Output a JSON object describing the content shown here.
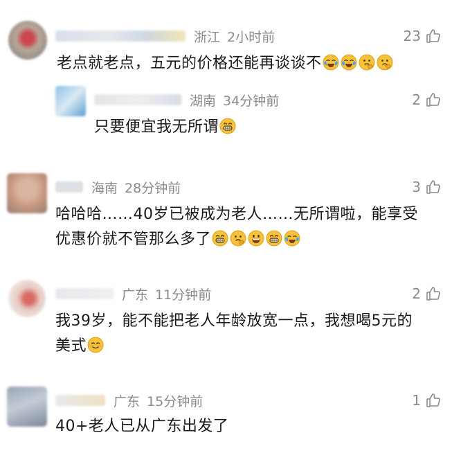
{
  "comments": [
    {
      "location": "浙江",
      "time": "2小时前",
      "likes": "23",
      "text": "老点就老点，五元的价格还能再谈谈不",
      "emojis": [
        "crying-laugh-icon",
        "crying-laugh-icon",
        "thinking-face-icon",
        "thinking-face-icon"
      ],
      "reply": {
        "location": "湖南",
        "time": "34分钟前",
        "likes": "2",
        "text": "只要便宜我无所谓",
        "emojis": [
          "grinning-teeth-icon"
        ]
      }
    },
    {
      "location": "海南",
      "time": "28分钟前",
      "likes": "3",
      "text_line1": "哈哈哈……40岁已被成为老人……无所谓啦，能享受",
      "text_line2": "优惠价就不管那么多了",
      "emojis": [
        "grinning-teeth-icon",
        "thinking-face-icon",
        "big-grin-icon",
        "grinning-teeth-icon",
        "crying-laugh-icon"
      ]
    },
    {
      "location": "广东",
      "time": "11分钟前",
      "likes": "2",
      "text_line1": "我39岁，能不能把老人年龄放宽一点，我想喝5元的",
      "text_line2": "美式",
      "emojis": [
        "blush-smile-icon"
      ]
    },
    {
      "location": "广东",
      "time": "15分钟前",
      "likes": "1",
      "text": "40+老人已从广东出发了"
    }
  ],
  "colors": {
    "meta_text": "#8a8a8a",
    "body_text": "#1a1a1a",
    "emoji_yellow": "#f6c23a"
  }
}
